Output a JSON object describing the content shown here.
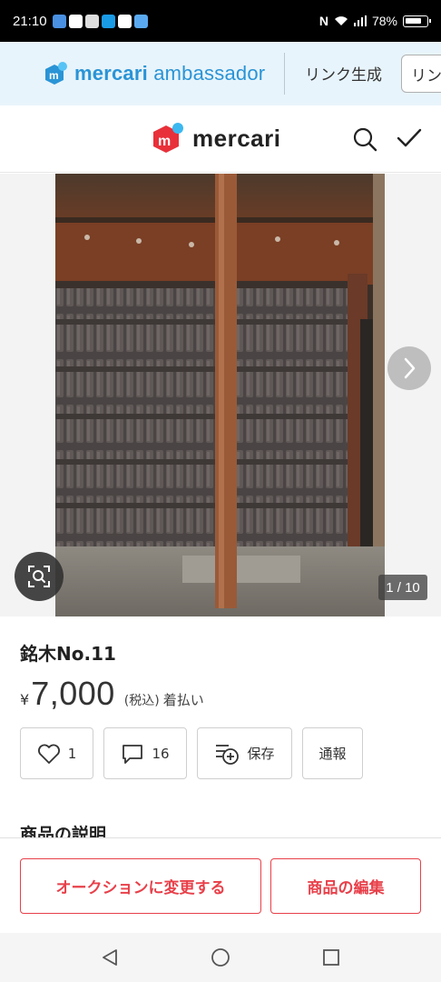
{
  "status_bar": {
    "time": "21:10",
    "battery": "78%",
    "app_icon_colors": [
      "#4a90e2",
      "#ffffff",
      "#dddddd",
      "#1a9be6",
      "#ffffff",
      "#5aa9f0"
    ]
  },
  "ambassador": {
    "brand_bold": "mercari",
    "brand_light": " ambassador",
    "link_label": "リンク生成",
    "button_label": "リンク"
  },
  "header": {
    "logo_text": "mercari",
    "icons": [
      "search-icon",
      "check-icon"
    ]
  },
  "gallery": {
    "counter": "1 / 10",
    "icons": [
      "chevron-right-icon",
      "lens-search-icon"
    ]
  },
  "item": {
    "title": "銘木No.11",
    "currency": "¥",
    "price": "7,000",
    "tax_note": "(税込)",
    "shipping": "着払い"
  },
  "actions": {
    "like_count": "1",
    "comment_count": "16",
    "save_label": "保存",
    "report_label": "通報"
  },
  "description": {
    "heading": "商品の説明"
  },
  "bottom_actions": {
    "auction_label": "オークションに変更する",
    "edit_label": "商品の編集"
  },
  "colors": {
    "accent_red": "#e8404a",
    "ambassador_blue": "#2a94d6",
    "ambassador_bg": "#e8f4fb"
  },
  "navbar": {
    "icons": [
      "back-icon",
      "home-icon",
      "recents-icon"
    ]
  }
}
